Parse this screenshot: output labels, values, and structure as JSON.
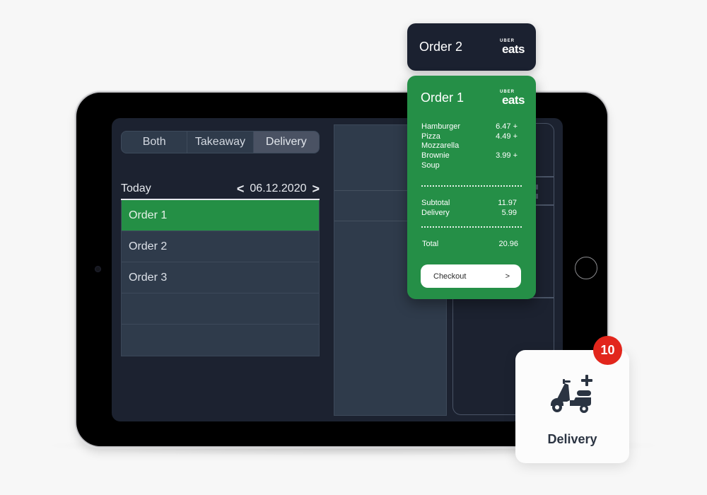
{
  "filter_tabs": [
    {
      "label": "Both",
      "active": false
    },
    {
      "label": "Takeaway",
      "active": false
    },
    {
      "label": "Delivery",
      "active": true
    }
  ],
  "date_bar": {
    "label": "Today",
    "date": "06.12.2020",
    "prev_icon": "<",
    "next_icon": ">"
  },
  "orders": [
    {
      "label": "Order 1",
      "selected": true
    },
    {
      "label": "Order 2",
      "selected": false
    },
    {
      "label": "Order 3",
      "selected": false
    },
    {
      "label": "",
      "selected": false
    },
    {
      "label": "",
      "selected": false
    }
  ],
  "order2_card": {
    "title": "Order 2",
    "brand_top": "UBER",
    "brand_bottom": "eats"
  },
  "order1_card": {
    "title": "Order 1",
    "brand_top": "UBER",
    "brand_bottom": "eats",
    "items": [
      {
        "name": "Hamburger",
        "price": "6.47 +"
      },
      {
        "name": "Pizza",
        "price": "4.49 +"
      },
      {
        "name": "Mozzarella",
        "price": ""
      },
      {
        "name": "Brownie",
        "price": "3.99 +"
      },
      {
        "name": "Soup",
        "price": ""
      }
    ],
    "subtotal_label": "Subtotal",
    "subtotal_value": "11.97",
    "delivery_label": "Delivery",
    "delivery_value": "5.99",
    "total_label": "Total",
    "total_value": "20.96",
    "checkout_label": "Checkout",
    "checkout_icon": ">"
  },
  "delivery_tile": {
    "label": "Delivery",
    "badge_count": "10",
    "icon": "scooter-plus-icon"
  },
  "colors": {
    "accent_green": "#258f47",
    "badge_red": "#e2261c",
    "screen_bg": "#1c2230",
    "row_bg": "#2f3b4b"
  }
}
